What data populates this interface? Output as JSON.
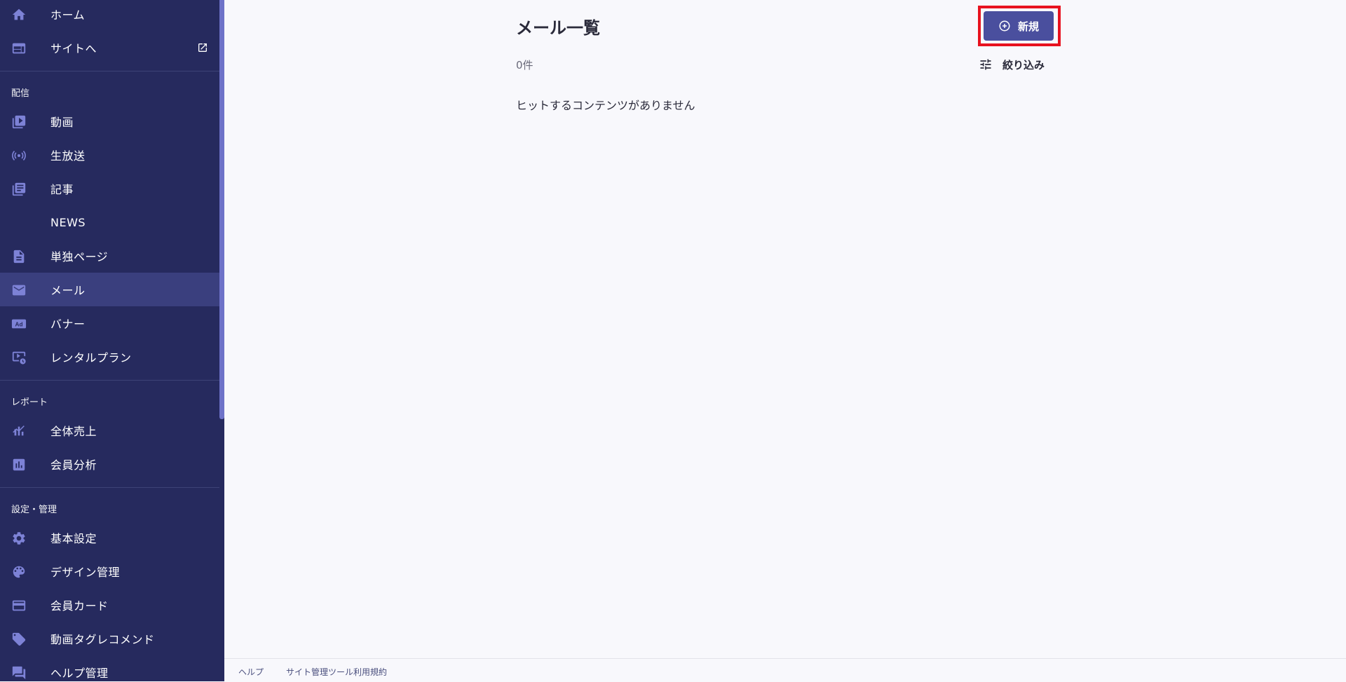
{
  "sidebar": {
    "top": [
      {
        "label": "ホーム",
        "icon": "home-icon"
      },
      {
        "label": "サイトへ",
        "icon": "site-icon",
        "external_icon": "open-in-new-icon"
      }
    ],
    "sections": [
      {
        "title": "配信",
        "items": [
          {
            "label": "動画",
            "icon": "video-library-icon"
          },
          {
            "label": "生放送",
            "icon": "live-broadcast-icon"
          },
          {
            "label": "記事",
            "icon": "article-icon"
          },
          {
            "label": "NEWS",
            "icon": ""
          },
          {
            "label": "単独ページ",
            "icon": "document-icon"
          },
          {
            "label": "メール",
            "icon": "mail-icon",
            "active": true
          },
          {
            "label": "バナー",
            "icon": "ad-icon"
          },
          {
            "label": "レンタルプラン",
            "icon": "rental-plan-icon"
          }
        ]
      },
      {
        "title": "レポート",
        "items": [
          {
            "label": "全体売上",
            "icon": "sales-chart-icon"
          },
          {
            "label": "会員分析",
            "icon": "analytics-icon"
          }
        ]
      },
      {
        "title": "設定・管理",
        "items": [
          {
            "label": "基本設定",
            "icon": "gear-icon"
          },
          {
            "label": "デザイン管理",
            "icon": "palette-icon"
          },
          {
            "label": "会員カード",
            "icon": "credit-card-icon"
          },
          {
            "label": "動画タグレコメンド",
            "icon": "tag-icon"
          },
          {
            "label": "ヘルプ管理",
            "icon": "chat-icon"
          }
        ]
      }
    ]
  },
  "main": {
    "title": "メール一覧",
    "count": "0件",
    "empty_message": "ヒットするコンテンツがありません",
    "new_button": "新規",
    "filter_label": "絞り込み"
  },
  "footer": {
    "help": "ヘルプ",
    "terms": "サイト管理ツール利用規約"
  },
  "colors": {
    "sidebar_bg": "#262a5e",
    "sidebar_active": "#3a3f7e",
    "icon": "#7d82d6",
    "primary_button": "#4a4f9e",
    "highlight_outline": "#e8121f",
    "page_bg": "#f8f8fc"
  }
}
